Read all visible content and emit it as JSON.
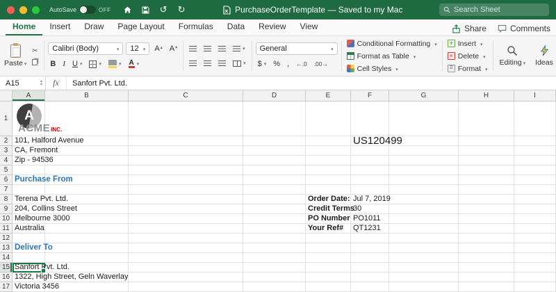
{
  "titlebar": {
    "autosave_label": "AutoSave",
    "autosave_state": "OFF",
    "title": "PurchaseOrderTemplate — Saved to my Mac",
    "search_placeholder": "Search Sheet"
  },
  "ribbon_tabs": [
    {
      "label": "Home",
      "active": true
    },
    {
      "label": "Insert"
    },
    {
      "label": "Draw"
    },
    {
      "label": "Page Layout"
    },
    {
      "label": "Formulas"
    },
    {
      "label": "Data"
    },
    {
      "label": "Review"
    },
    {
      "label": "View"
    }
  ],
  "actions": {
    "share": "Share",
    "comments": "Comments"
  },
  "ribbon": {
    "paste": "Paste",
    "font_name": "Calibri (Body)",
    "font_size": "12",
    "font_letter": "A",
    "bold": "B",
    "italic": "I",
    "underline": "U",
    "font_color_letter": "A",
    "currency": "$",
    "percent": "%",
    "comma": ",",
    "dec_increase": "←.0",
    "dec_decrease": ".00→",
    "number_format": "General",
    "conditional_formatting": "Conditional Formatting",
    "format_as_table": "Format as Table",
    "cell_styles": "Cell Styles",
    "insert": "Insert",
    "delete": "Delete",
    "format": "Format",
    "editing": "Editing",
    "ideas": "Ideas"
  },
  "formula_bar": {
    "name_box": "A15",
    "fx": "fx",
    "content": "Sanfort Pvt. Ltd."
  },
  "sheet": {
    "columns": [
      "A",
      "B",
      "C",
      "D",
      "E",
      "F",
      "G",
      "H",
      "I"
    ],
    "row_count": 17,
    "selected_cell": "A15",
    "logo": {
      "letter": "A",
      "brand": "ACME",
      "suffix": "INC."
    },
    "cells": {
      "A2": "101, Halford Avenue",
      "A3": "CA, Fremont",
      "A4": "Zip - 94536",
      "A6": "Purchase From",
      "A8": "Terena Pvt. Ltd.",
      "A9": "204, Collins Street",
      "A10": "Melbourne 3000",
      "A11": "Australia",
      "A13": "Deliver To",
      "A15": "Sanfort Pvt. Ltd.",
      "A16": "1322, High Street, Geln Waverlay",
      "A17": "Victoria 3456",
      "F2": "US120499",
      "E8": "Order Date:",
      "F8": "Jul 7, 2019",
      "E9": "Credit Terms",
      "F9": "30",
      "E10": "PO Number",
      "F10": "PO1011",
      "E11": "Your Ref#",
      "F11": "QT1231"
    },
    "cell_styles": {
      "A6": "heading",
      "A13": "heading",
      "E8": "bold",
      "E9": "bold",
      "E10": "bold",
      "E11": "bold",
      "F2": "big"
    },
    "colors": {
      "accent_green": "#217346",
      "heading_blue": "#2e75b6",
      "brand_red": "#c00000"
    }
  }
}
